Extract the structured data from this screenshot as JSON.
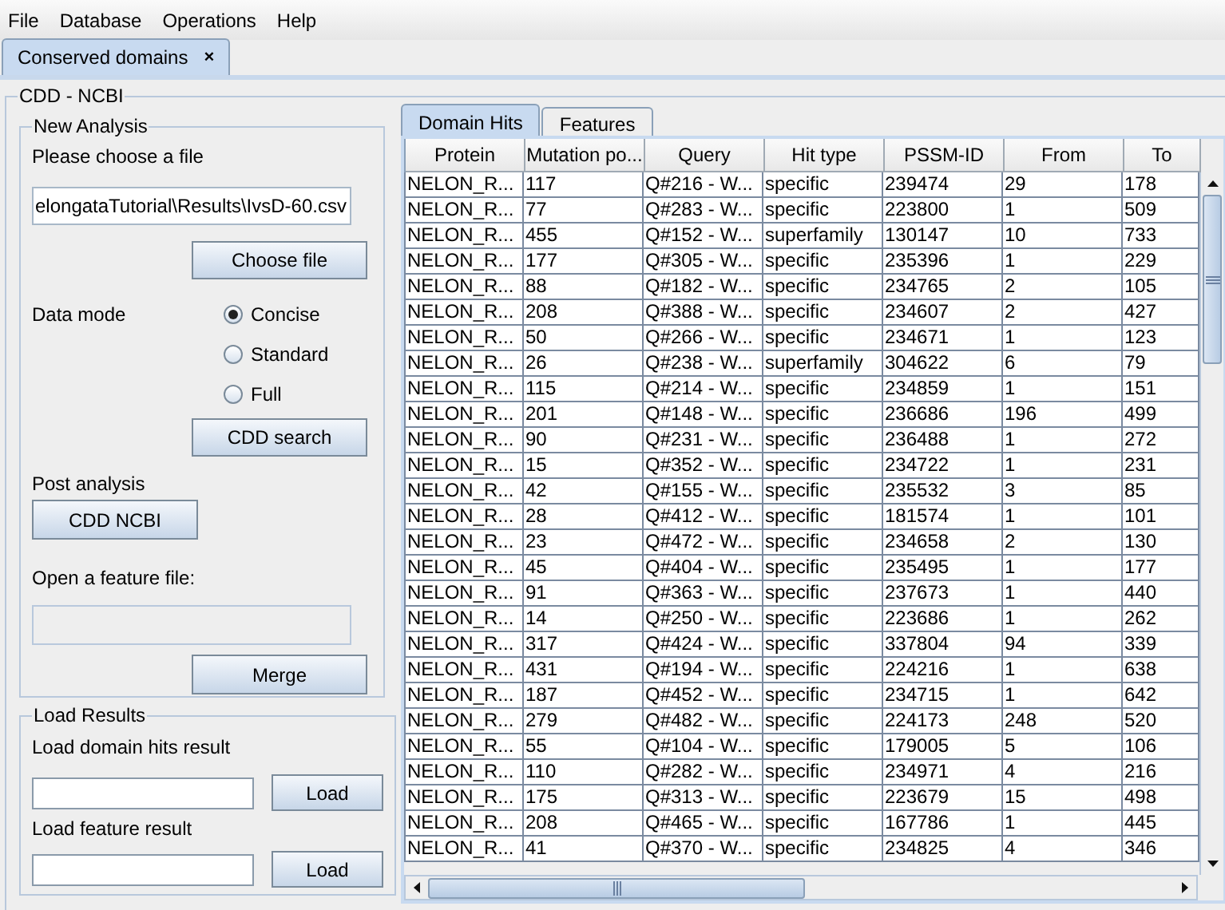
{
  "menu": [
    "File",
    "Database",
    "Operations",
    "Help"
  ],
  "doc_tabs": [
    {
      "label": "Conserved domains",
      "close": "×",
      "selected": true
    }
  ],
  "panel_title": "CDD - NCBI",
  "new_analysis": {
    "title": "New Analysis",
    "file_label": "Please choose a file",
    "file_value": "elongataTutorial\\Results\\IvsD-60.csv",
    "choose_button": "Choose file",
    "data_mode_label": "Data mode",
    "modes": [
      {
        "label": "Concise",
        "selected": true
      },
      {
        "label": "Standard",
        "selected": false
      },
      {
        "label": "Full",
        "selected": false
      }
    ],
    "search_button": "CDD search",
    "post_label": "Post analysis",
    "ncbi_button": "CDD NCBI",
    "feature_label": "Open a feature file:",
    "merge_button": "Merge"
  },
  "load_results": {
    "title": "Load Results",
    "hits_label": "Load domain hits result",
    "hits_button": "Load",
    "feature_label": "Load feature result",
    "feature_button": "Load"
  },
  "result_tabs": [
    {
      "label": "Domain Hits",
      "selected": true
    },
    {
      "label": "Features",
      "selected": false
    }
  ],
  "table": {
    "columns": [
      "Protein",
      "Mutation po...",
      "Query",
      "Hit type",
      "PSSM-ID",
      "From",
      "To"
    ],
    "rows": [
      [
        "NELON_R...",
        "117",
        "Q#216 - W...",
        "specific",
        "239474",
        "29",
        "178"
      ],
      [
        "NELON_R...",
        "77",
        "Q#283 - W...",
        "specific",
        "223800",
        "1",
        "509"
      ],
      [
        "NELON_R...",
        "455",
        "Q#152 - W...",
        "superfamily",
        "130147",
        "10",
        "733"
      ],
      [
        "NELON_R...",
        "177",
        "Q#305 - W...",
        "specific",
        "235396",
        "1",
        "229"
      ],
      [
        "NELON_R...",
        "88",
        "Q#182 - W...",
        "specific",
        "234765",
        "2",
        "105"
      ],
      [
        "NELON_R...",
        "208",
        "Q#388 - W...",
        "specific",
        "234607",
        "2",
        "427"
      ],
      [
        "NELON_R...",
        "50",
        "Q#266 - W...",
        "specific",
        "234671",
        "1",
        "123"
      ],
      [
        "NELON_R...",
        "26",
        "Q#238 - W...",
        "superfamily",
        "304622",
        "6",
        "79"
      ],
      [
        "NELON_R...",
        "115",
        "Q#214 - W...",
        "specific",
        "234859",
        "1",
        "151"
      ],
      [
        "NELON_R...",
        "201",
        "Q#148 - W...",
        "specific",
        "236686",
        "196",
        "499"
      ],
      [
        "NELON_R...",
        "90",
        "Q#231 - W...",
        "specific",
        "236488",
        "1",
        "272"
      ],
      [
        "NELON_R...",
        "15",
        "Q#352 - W...",
        "specific",
        "234722",
        "1",
        "231"
      ],
      [
        "NELON_R...",
        "42",
        "Q#155 - W...",
        "specific",
        "235532",
        "3",
        "85"
      ],
      [
        "NELON_R...",
        "28",
        "Q#412 - W...",
        "specific",
        "181574",
        "1",
        "101"
      ],
      [
        "NELON_R...",
        "23",
        "Q#472 - W...",
        "specific",
        "234658",
        "2",
        "130"
      ],
      [
        "NELON_R...",
        "45",
        "Q#404 - W...",
        "specific",
        "235495",
        "1",
        "177"
      ],
      [
        "NELON_R...",
        "91",
        "Q#363 - W...",
        "specific",
        "237673",
        "1",
        "440"
      ],
      [
        "NELON_R...",
        "14",
        "Q#250 - W...",
        "specific",
        "223686",
        "1",
        "262"
      ],
      [
        "NELON_R...",
        "317",
        "Q#424 - W...",
        "specific",
        "337804",
        "94",
        "339"
      ],
      [
        "NELON_R...",
        "431",
        "Q#194 - W...",
        "specific",
        "224216",
        "1",
        "638"
      ],
      [
        "NELON_R...",
        "187",
        "Q#452 - W...",
        "specific",
        "234715",
        "1",
        "642"
      ],
      [
        "NELON_R...",
        "279",
        "Q#482 - W...",
        "specific",
        "224173",
        "248",
        "520"
      ],
      [
        "NELON_R...",
        "55",
        "Q#104 - W...",
        "specific",
        "179005",
        "5",
        "106"
      ],
      [
        "NELON_R...",
        "110",
        "Q#282 - W...",
        "specific",
        "234971",
        "4",
        "216"
      ],
      [
        "NELON_R...",
        "175",
        "Q#313 - W...",
        "specific",
        "223679",
        "15",
        "498"
      ],
      [
        "NELON_R...",
        "208",
        "Q#465 - W...",
        "specific",
        "167786",
        "1",
        "445"
      ],
      [
        "NELON_R...",
        "41",
        "Q#370 - W...",
        "specific",
        "234825",
        "4",
        "346"
      ]
    ]
  }
}
